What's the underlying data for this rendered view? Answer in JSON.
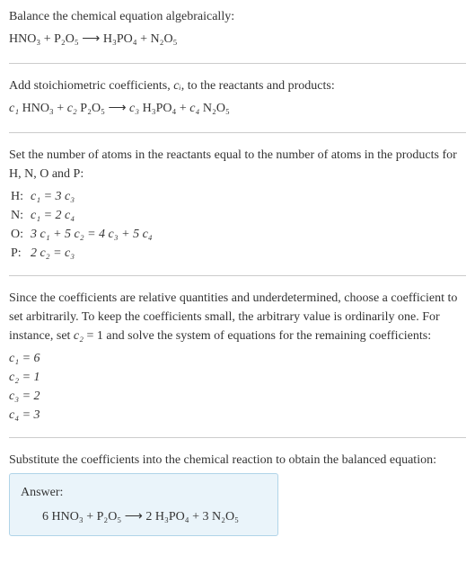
{
  "section1": {
    "title": "Balance the chemical equation algebraically:",
    "equation": "HNO₃ + P₂O₅ ⟶ H₃PO₄ + N₂O₅"
  },
  "section2": {
    "title_a": "Add stoichiometric coefficients, ",
    "title_var": "cᵢ",
    "title_b": ", to the reactants and products:",
    "equation_c1": "c₁",
    "eq_sp1": " HNO₃ + ",
    "equation_c2": "c₂",
    "eq_sp2": " P₂O₅ ⟶ ",
    "equation_c3": "c₃",
    "eq_sp3": " H₃PO₄ + ",
    "equation_c4": "c₄",
    "eq_sp4": " N₂O₅"
  },
  "section3": {
    "title": "Set the number of atoms in the reactants equal to the number of atoms in the products for H, N, O and P:",
    "rows": [
      {
        "elem": "H:",
        "eq_a": "c₁ = 3 c₃"
      },
      {
        "elem": "N:",
        "eq_a": "c₁ = 2 c₄"
      },
      {
        "elem": "O:",
        "eq_a": "3 c₁ + 5 c₂ = 4 c₃ + 5 c₄"
      },
      {
        "elem": "P:",
        "eq_a": "2 c₂ = c₃"
      }
    ]
  },
  "section4": {
    "text_a": "Since the coefficients are relative quantities and underdetermined, choose a coefficient to set arbitrarily. To keep the coefficients small, the arbitrary value is ordinarily one. For instance, set ",
    "var": "c₂",
    "text_b": " = 1 and solve the system of equations for the remaining coefficients:",
    "lines": [
      "c₁ = 6",
      "c₂ = 1",
      "c₃ = 2",
      "c₄ = 3"
    ]
  },
  "section5": {
    "title": "Substitute the coefficients into the chemical reaction to obtain the balanced equation:",
    "answer_label": "Answer:",
    "answer_eq": "6 HNO₃ + P₂O₅ ⟶ 2 H₃PO₄ + 3 N₂O₅"
  }
}
